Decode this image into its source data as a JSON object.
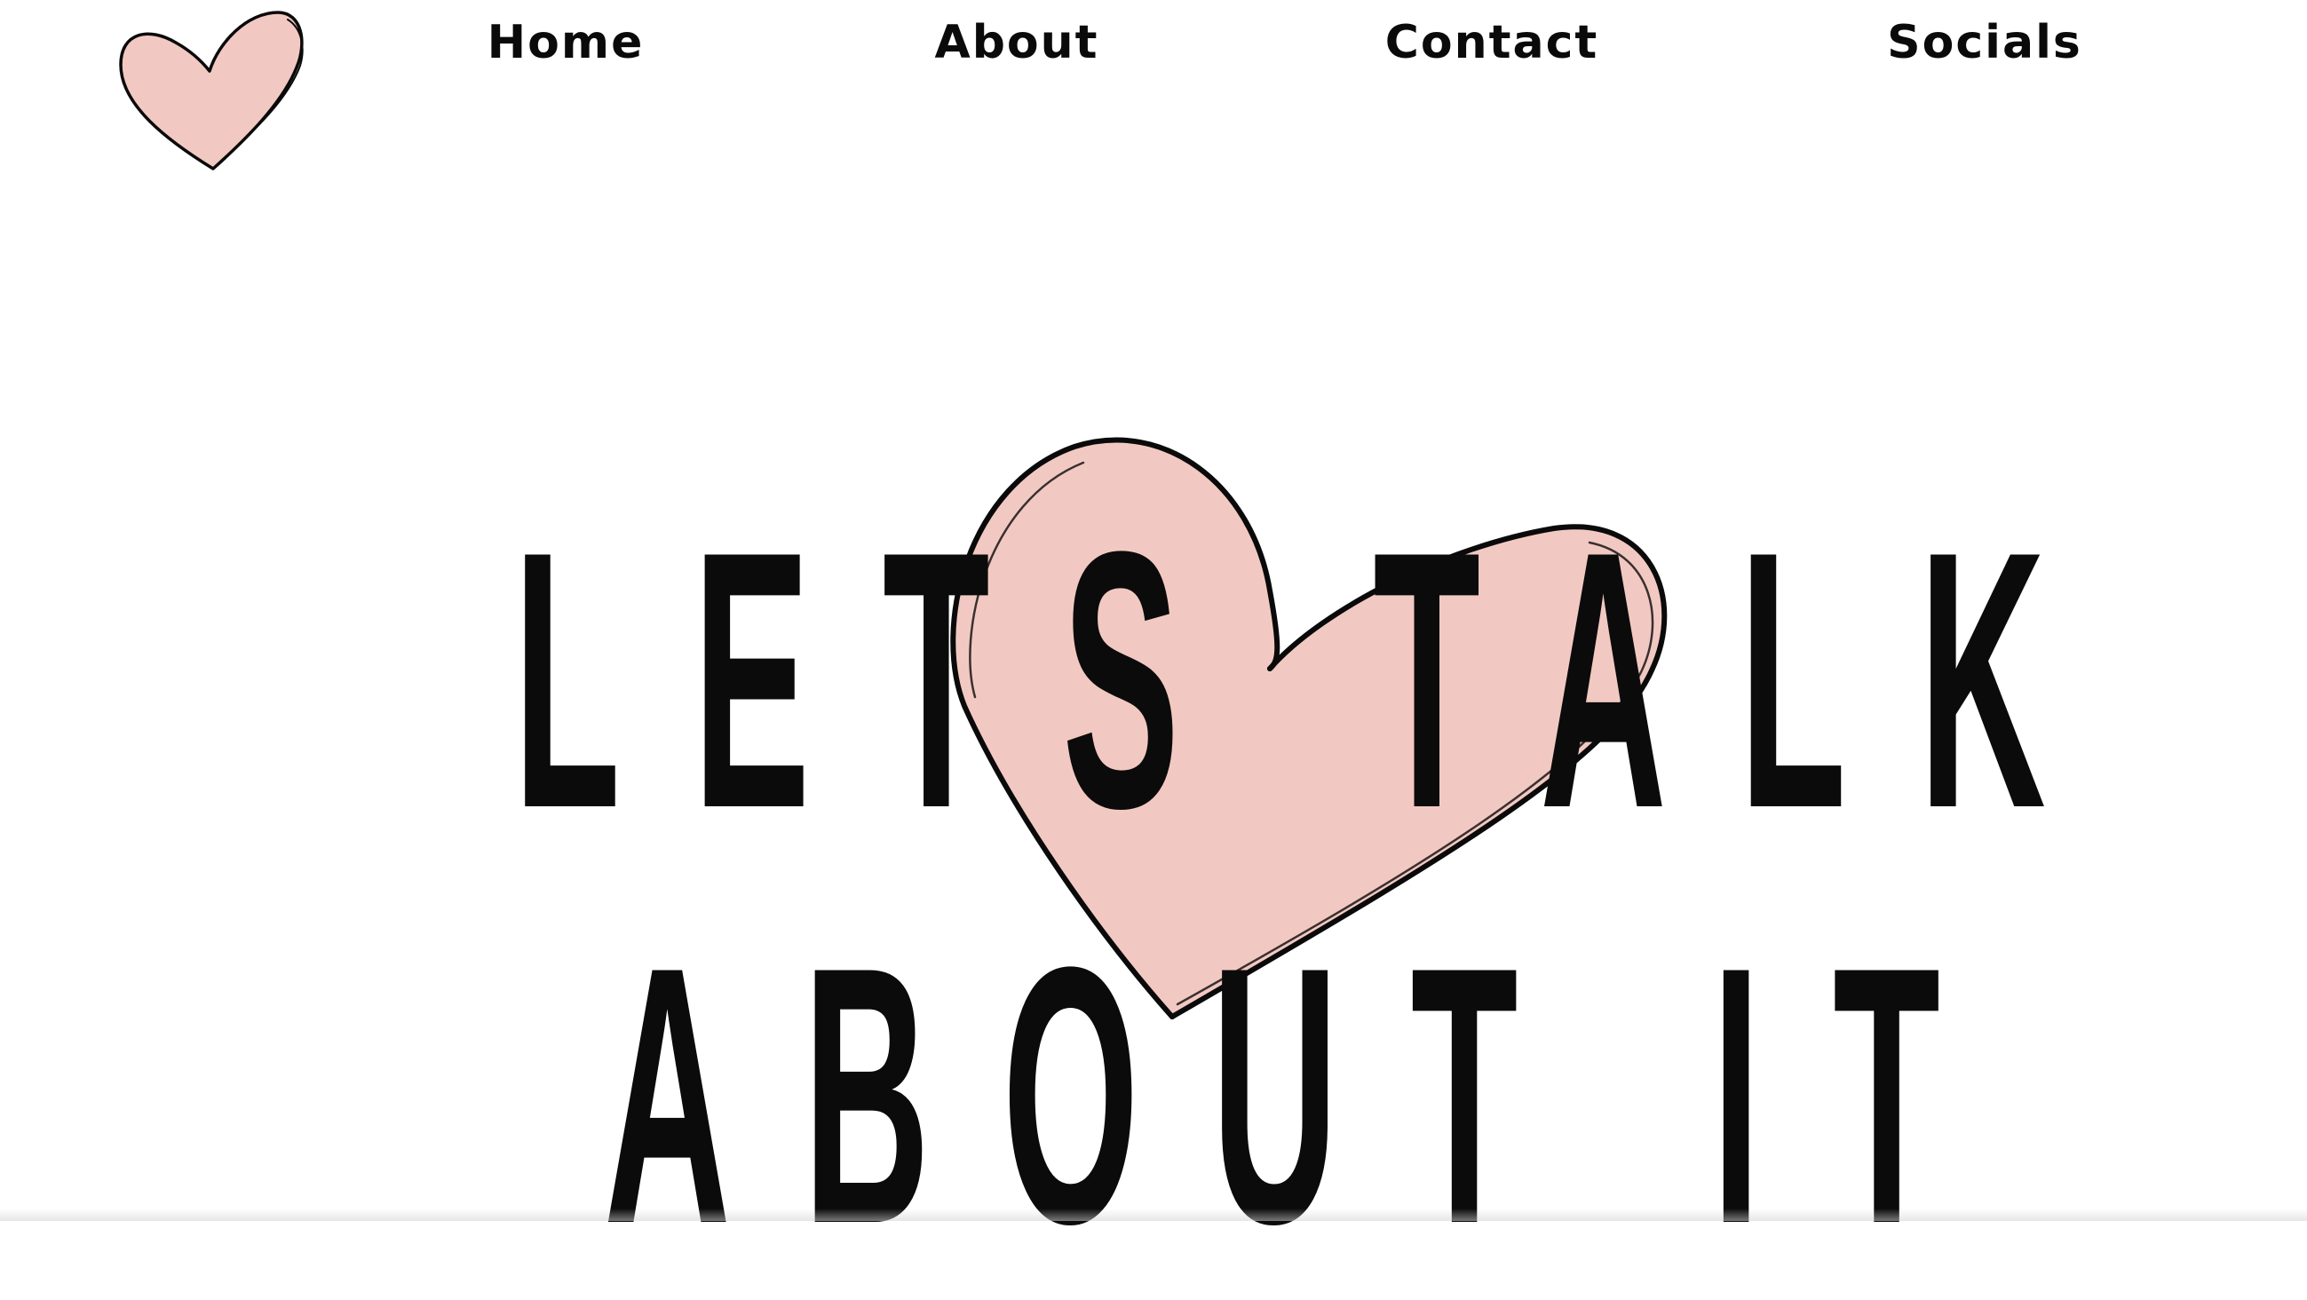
{
  "header": {
    "logo": {
      "icon": "heart-icon",
      "fill_color": "#f2c9c2",
      "stroke_color": "#0a0a0a"
    },
    "nav": [
      {
        "label": "Home"
      },
      {
        "label": "About"
      },
      {
        "label": "Contact"
      },
      {
        "label": "Socials"
      }
    ]
  },
  "hero": {
    "line1": "LETS TALK",
    "line2": "ABOUT IT",
    "heart": {
      "icon": "heart-icon",
      "fill_color": "#f2c9c2",
      "stroke_color": "#0a0a0a"
    }
  },
  "colors": {
    "background": "#ffffff",
    "text": "#0b0b0b",
    "accent_pink": "#f2c9c2"
  }
}
